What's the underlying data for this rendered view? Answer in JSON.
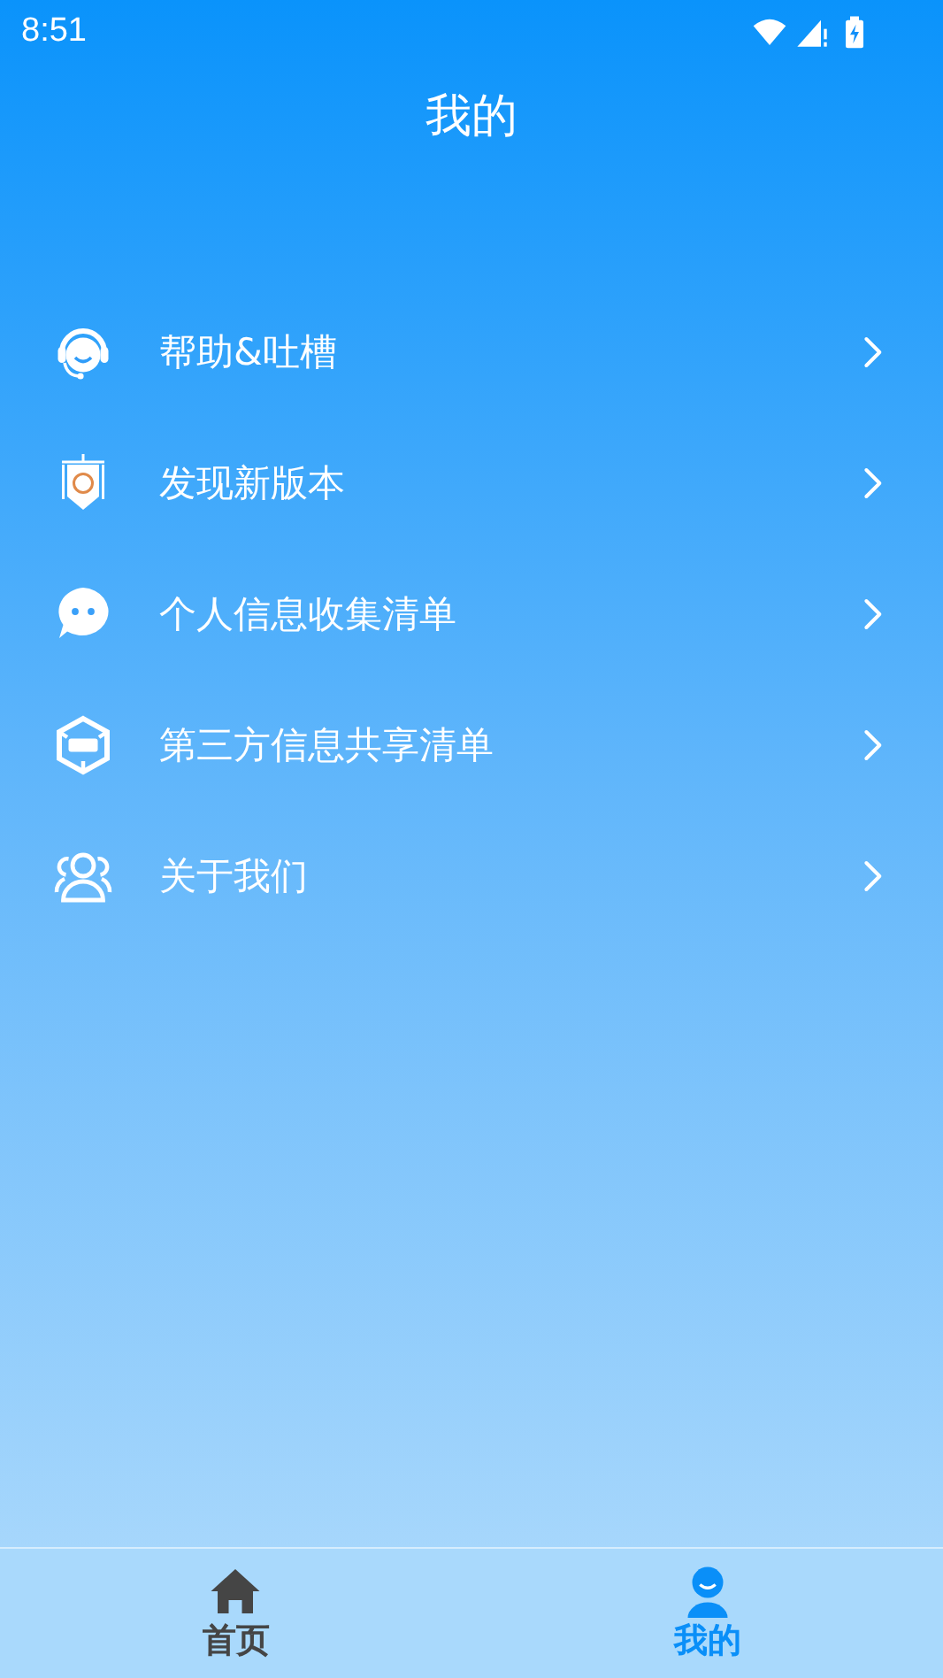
{
  "status_bar": {
    "time": "8:51"
  },
  "title": "我的",
  "menu": [
    {
      "label": "帮助&吐槽"
    },
    {
      "label": "发现新版本"
    },
    {
      "label": "个人信息收集清单"
    },
    {
      "label": "第三方信息共享清单"
    },
    {
      "label": "关于我们"
    }
  ],
  "tabs": [
    {
      "label": "首页",
      "selected": false
    },
    {
      "label": "我的",
      "selected": true
    }
  ]
}
